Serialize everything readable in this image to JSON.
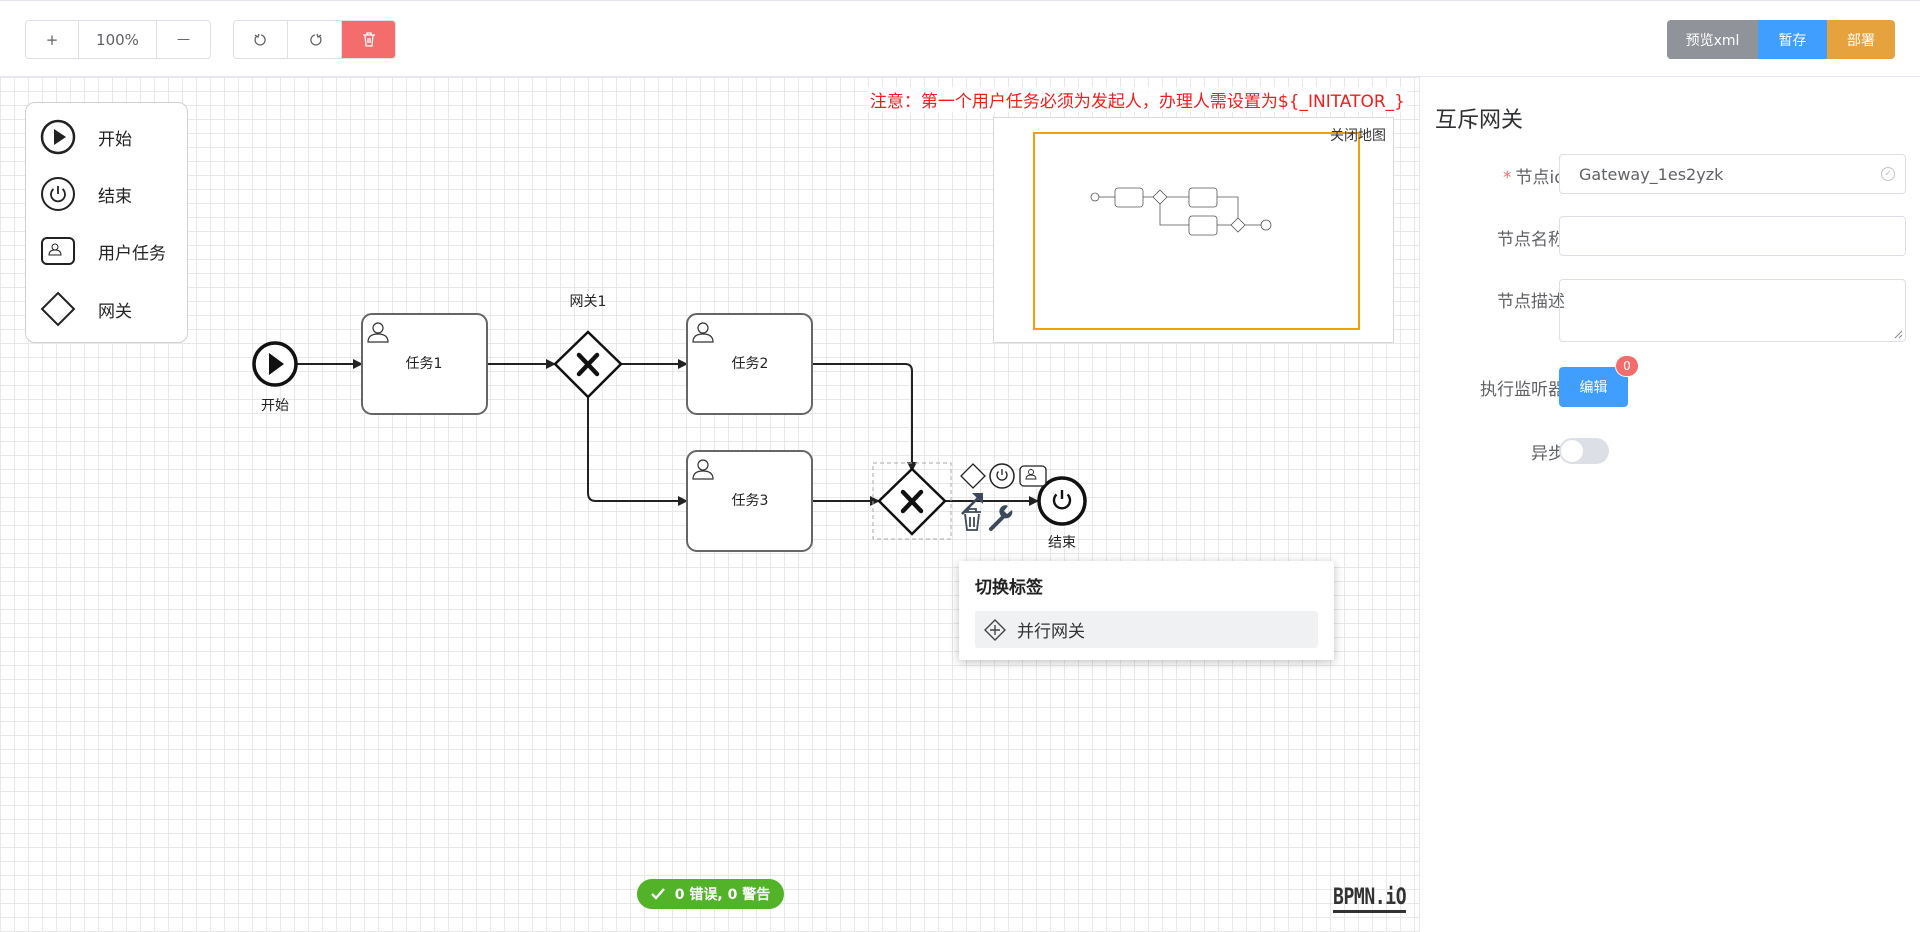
{
  "toolbar": {
    "zoom_in": "+",
    "zoom_level": "100%",
    "zoom_out": "—",
    "preview_label": "预览xml",
    "save_label": "暂存",
    "deploy_label": "部署",
    "colors": {
      "preview": "#909399",
      "save": "#409eff",
      "deploy": "#e6a23c",
      "delete": "#f56c6c"
    }
  },
  "notice": "注意：第一个用户任务必须为发起人，办理人需设置为${_INITATOR_}",
  "palette": {
    "items": [
      {
        "label": "开始",
        "icon": "start-event-icon"
      },
      {
        "label": "结束",
        "icon": "end-event-icon"
      },
      {
        "label": "用户任务",
        "icon": "user-task-icon"
      },
      {
        "label": "网关",
        "icon": "gateway-icon"
      }
    ]
  },
  "minimap": {
    "close_label": "关闭地图"
  },
  "diagram": {
    "start_label": "开始",
    "task1": "任务1",
    "gateway1": "网关1",
    "task2": "任务2",
    "task3": "任务3",
    "end_label": "结束"
  },
  "context_pad": {
    "icons": [
      "gateway-icon",
      "end-event-icon",
      "user-task-icon",
      "connect-arrow-icon",
      "trash-icon",
      "wrench-icon"
    ]
  },
  "switch_popup": {
    "title": "切换标签",
    "entry": "并行网关"
  },
  "status": {
    "text": "0 错误, 0 警告",
    "color": "#52b328"
  },
  "logo": "BPMN.iO",
  "properties": {
    "title": "互斥网关",
    "fields": {
      "node_id_label": "节点id",
      "node_id_value": "Gateway_1es2yzk",
      "node_name_label": "节点名称",
      "node_desc_label": "节点描述",
      "listener_label": "执行监听器",
      "listener_button": "编辑",
      "listener_count": "0",
      "async_label": "异步"
    }
  }
}
